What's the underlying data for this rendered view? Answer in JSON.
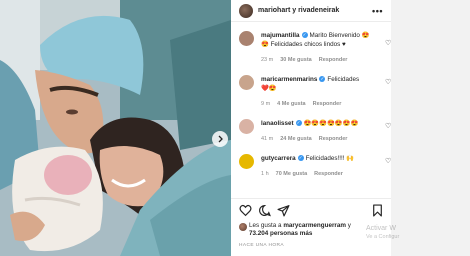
{
  "post": {
    "username": "mariohart y rivadeneirak",
    "more_icon": "more-horizontal-icon",
    "photo_icon": "photo-newborn-hospital"
  },
  "comments": [
    {
      "user": "majumantilla",
      "verified": true,
      "text": "Marito Bienvenido 😍😍 Felicidades chicos lindos ♥",
      "time": "23 m",
      "likes": "30 Me gusta",
      "reply": "Responder",
      "avatar_color": "#a9826f"
    },
    {
      "user": "maricarmenmarins",
      "verified": true,
      "text": "Felicidades",
      "extra": "❤️😍",
      "time": "9 m",
      "likes": "4 Me gusta",
      "reply": "Responder",
      "avatar_color": "#c8a48c"
    },
    {
      "user": "lanaolisset",
      "verified": true,
      "text": "😍😍😍😍😍😍😍",
      "time": "41 m",
      "likes": "24 Me gusta",
      "reply": "Responder",
      "avatar_color": "#d9b2a4"
    },
    {
      "user": "gutycarrera",
      "verified": true,
      "text": "Felicidades!!!! 🙌",
      "time": "1 h",
      "likes": "70 Me gusta",
      "reply": "Responder",
      "avatar_color": "#e6b800"
    }
  ],
  "likes": {
    "prefix": "Les gusta a",
    "user": "marycarmenguerram",
    "suffix": "y",
    "count": "73.204 personas más"
  },
  "posted": "HACE UNA HORA",
  "watermark": {
    "line1": "Activar W",
    "line2": "Ve a Configur"
  }
}
